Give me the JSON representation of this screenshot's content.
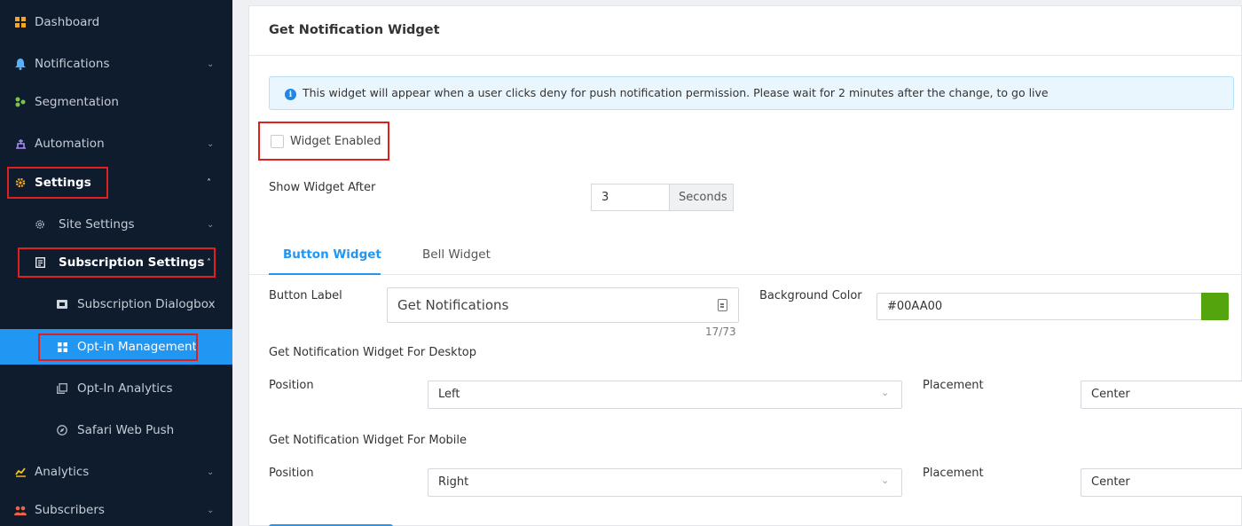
{
  "sidebar": {
    "items": [
      {
        "label": "Dashboard",
        "icon": "dashboard-icon"
      },
      {
        "label": "Notifications",
        "icon": "bell-icon"
      },
      {
        "label": "Segmentation",
        "icon": "segmentation-icon"
      },
      {
        "label": "Automation",
        "icon": "automation-icon"
      },
      {
        "label": "Settings",
        "icon": "gear-icon"
      },
      {
        "label": "Site Settings",
        "icon": "settings-cog-icon"
      },
      {
        "label": "Subscription Settings",
        "icon": "subscription-settings-icon"
      },
      {
        "label": "Subscription Dialogbox",
        "icon": "dialogbox-icon"
      },
      {
        "label": "Opt-in Management",
        "icon": "grid-icon"
      },
      {
        "label": "Opt-In Analytics",
        "icon": "analytics-copy-icon"
      },
      {
        "label": "Safari Web Push",
        "icon": "compass-icon"
      },
      {
        "label": "Analytics",
        "icon": "chart-icon"
      },
      {
        "label": "Subscribers",
        "icon": "users-icon"
      }
    ]
  },
  "card": {
    "title": "Get Notification Widget",
    "alert": "This widget will appear when a user clicks deny for push notification permission. Please wait for 2 minutes after the change, to go live",
    "widget_enabled_label": "Widget Enabled",
    "widget_enabled_checked": false,
    "show_after_label": "Show Widget After",
    "show_after_value": "3",
    "show_after_unit": "Seconds",
    "tabs": [
      {
        "label": "Button Widget",
        "active": true
      },
      {
        "label": "Bell Widget",
        "active": false
      }
    ],
    "button_label_label": "Button Label",
    "button_label_value": "Get Notifications",
    "button_label_counter": "17/73",
    "bg_color_label": "Background Color",
    "bg_color_value": "#00AA00",
    "desktop_section": "Get Notification Widget For Desktop",
    "desktop_position_label": "Position",
    "desktop_position_value": "Left",
    "desktop_placement_label": "Placement",
    "desktop_placement_value": "Center",
    "mobile_section": "Get Notification Widget For Mobile",
    "mobile_position_label": "Position",
    "mobile_position_value": "Right",
    "mobile_placement_label": "Placement",
    "mobile_placement_value": "Center"
  },
  "colors": {
    "sidebar_bg": "#0f1c2e",
    "accent": "#2196f3",
    "highlight_box": "#e0201e",
    "swatch": "#54a40e"
  }
}
